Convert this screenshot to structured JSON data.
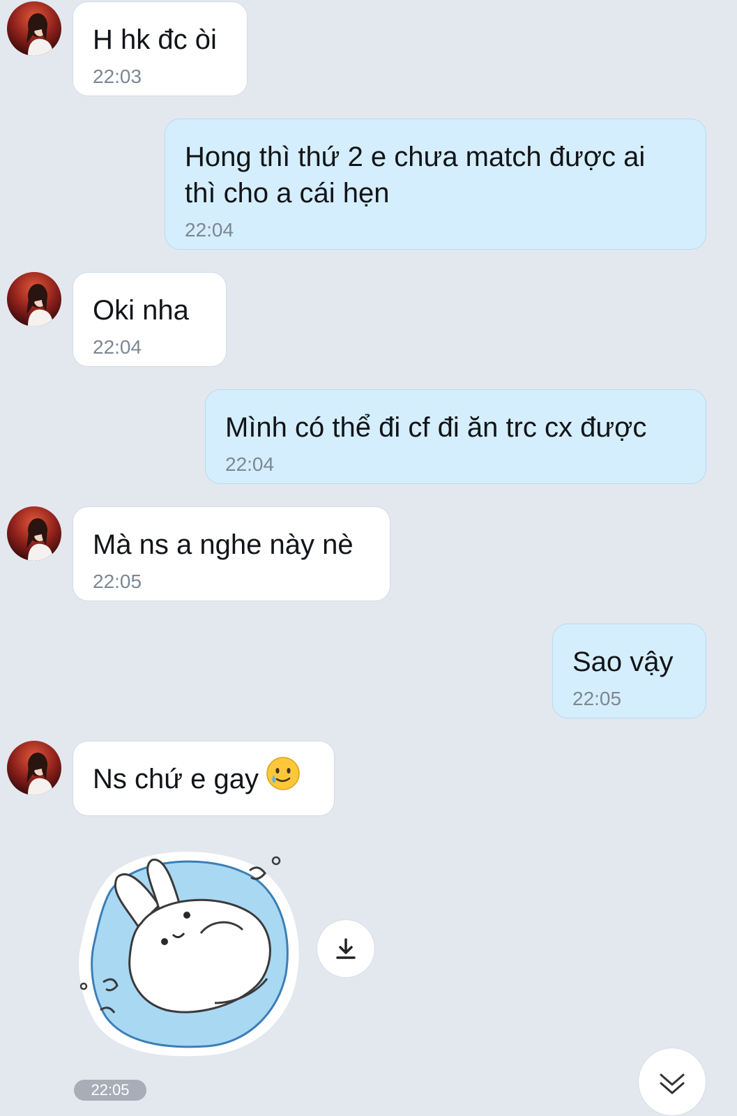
{
  "contact": {
    "avatar_icon": "contact-avatar-photo"
  },
  "messages": [
    {
      "sender": "contact",
      "text": "H hk đc òi",
      "time": "22:03"
    },
    {
      "sender": "me",
      "text_lines": [
        "Hong thì thứ 2 e chưa match được ai",
        "thì cho a cái hẹn"
      ],
      "time": "22:04"
    },
    {
      "sender": "contact",
      "text": "Oki nha",
      "time": "22:04"
    },
    {
      "sender": "me",
      "text": "Mình có thể đi cf đi ăn trc cx được",
      "time": "22:04"
    },
    {
      "sender": "contact",
      "text": "Mà ns a nghe này nè",
      "time": "22:05"
    },
    {
      "sender": "me",
      "text": "Sao vậy",
      "time": "22:05"
    },
    {
      "sender": "contact",
      "text": "Ns chứ e gay",
      "emoji": "crying-smiling-face-icon"
    }
  ],
  "sticker": {
    "description_icon": "bunny-splash-sticker",
    "download_icon": "download-icon",
    "time": "22:05"
  },
  "controls": {
    "scroll_down_icon": "chevron-down-double-icon"
  },
  "colors": {
    "background": "#e3e8ef",
    "incoming_bubble": "#ffffff",
    "outgoing_bubble": "#d5eefd",
    "time_text": "#7d8792"
  }
}
